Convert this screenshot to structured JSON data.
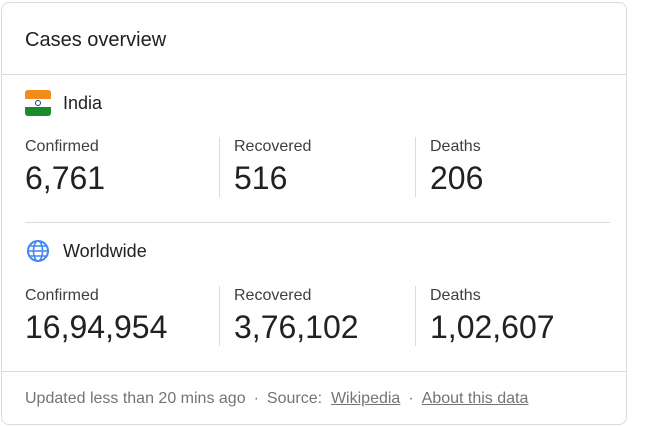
{
  "card": {
    "title": "Cases overview"
  },
  "regions": [
    {
      "name": "India",
      "icon": "india-flag-icon",
      "stats": [
        {
          "label": "Confirmed",
          "value": "6,761"
        },
        {
          "label": "Recovered",
          "value": "516"
        },
        {
          "label": "Deaths",
          "value": "206"
        }
      ]
    },
    {
      "name": "Worldwide",
      "icon": "globe-icon",
      "stats": [
        {
          "label": "Confirmed",
          "value": "16,94,954"
        },
        {
          "label": "Recovered",
          "value": "3,76,102"
        },
        {
          "label": "Deaths",
          "value": "1,02,607"
        }
      ]
    }
  ],
  "footer": {
    "updated": "Updated less than 20 mins ago",
    "separator": "·",
    "source_label": "Source:",
    "source_link": "Wikipedia",
    "about_link": "About this data"
  },
  "colors": {
    "border": "#dadce0",
    "text": "#202124",
    "muted": "#70757a",
    "globe": "#4285f4"
  }
}
